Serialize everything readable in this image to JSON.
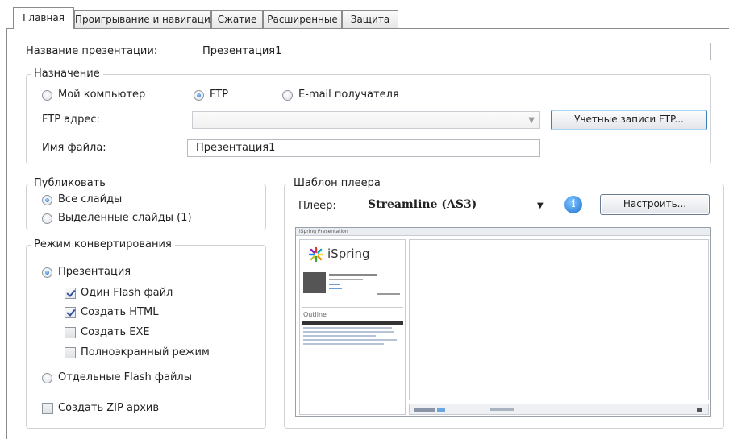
{
  "tabs": [
    "Главная",
    "Проигрывание и навигация",
    "Сжатие",
    "Расширенные",
    "Защита"
  ],
  "presentation_name": {
    "label": "Название презентации:",
    "value": "Презентация1"
  },
  "destination": {
    "legend": "Назначение",
    "options": [
      "Мой компьютер",
      "FTP",
      "E-mail получателя"
    ],
    "selected": "FTP",
    "ftp_label": "FTP адрес:",
    "ftp_value": "",
    "ftp_accounts_button": "Учетные записи FTP...",
    "filename_label": "Имя файла:",
    "filename_value": "Презентация1"
  },
  "publish": {
    "legend": "Публиковать",
    "options": [
      "Все слайды",
      "Выделенные слайды (1)"
    ],
    "selected": "Все слайды"
  },
  "convert_mode": {
    "legend": "Режим конвертирования",
    "presentation": "Презентация",
    "checks": [
      {
        "label": "Один Flash файл",
        "checked": true
      },
      {
        "label": "Создать HTML",
        "checked": true
      },
      {
        "label": "Создать EXE",
        "checked": false
      },
      {
        "label": "Полноэкранный режим",
        "checked": false
      }
    ],
    "separate": "Отдельные Flash файлы",
    "selected": "Презентация",
    "zip": {
      "label": "Создать ZIP архив",
      "checked": false
    }
  },
  "player_template": {
    "legend": "Шаблон плеера",
    "player_label": "Плеер:",
    "player_value": "Streamline (AS3)",
    "configure_button": "Настроить...",
    "preview": {
      "window_title": "iSpring Presentation",
      "logo_text": "iSpring",
      "outline_title": "Outline"
    }
  },
  "colors": {
    "accent": "#1e6fd0",
    "border": "#8b8b8b",
    "group_border": "#cfd3d8"
  }
}
